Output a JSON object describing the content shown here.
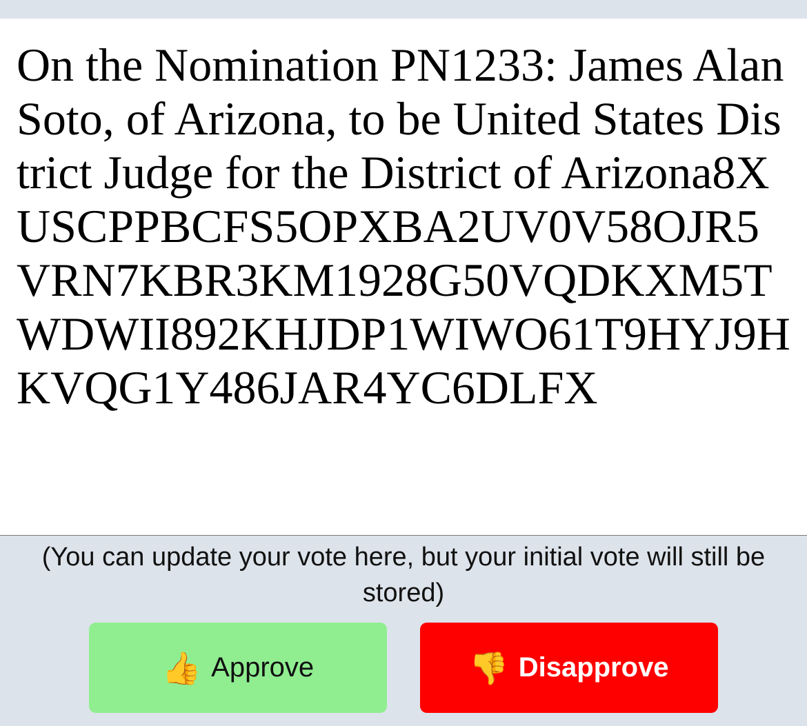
{
  "nomination": {
    "title": "On the Nomination PN1233: James Alan Soto, of Arizona, to be United States District Judge for the District of Arizona8XUSCPPBCFS5OPXBA2UV0V58OJR5VRN7KBR3KM1928G50VQDKXM5TWDWII892KHJDP1WIWO61T9HYJ9HKVQG1Y486JAR4YC6DLFX"
  },
  "vote": {
    "note": "(You can update your vote here, but your initial vote will still be stored)",
    "approve": {
      "icon": "👍",
      "icon_name": "thumbs-up-icon",
      "label": "Approve",
      "color": "#90ee90"
    },
    "disapprove": {
      "icon": "👎",
      "icon_name": "thumbs-down-icon",
      "label": "Disapprove",
      "color": "#ff0000"
    }
  }
}
